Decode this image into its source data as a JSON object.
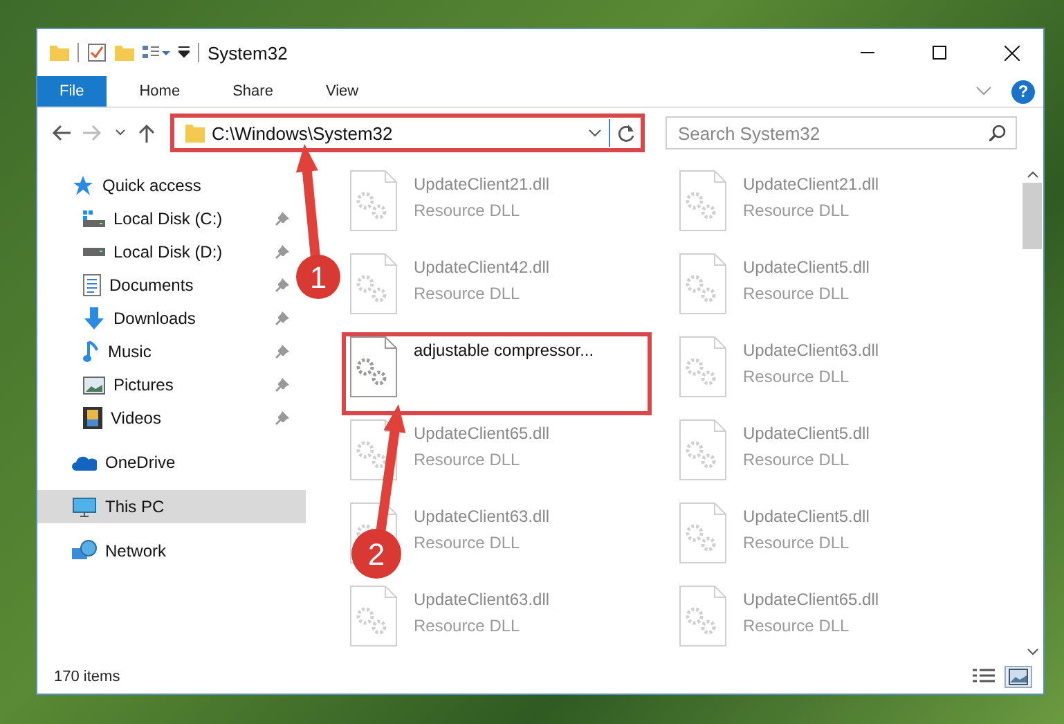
{
  "window": {
    "title": "System32"
  },
  "ribbon_tabs": [
    {
      "label": "File",
      "selected": true
    },
    {
      "label": "Home",
      "selected": false
    },
    {
      "label": "Share",
      "selected": false
    },
    {
      "label": "View",
      "selected": false
    }
  ],
  "help": {
    "glyph": "?"
  },
  "address_bar": {
    "path": "C:\\Windows\\System32",
    "highlighted": true
  },
  "search": {
    "placeholder": "Search System32"
  },
  "sidebar": {
    "items": [
      {
        "kind": "star",
        "label": "Quick access",
        "selected": false,
        "children": [
          {
            "kind": "drive-c",
            "label": "Local Disk (C:)",
            "pinned": true,
            "selected": false
          },
          {
            "kind": "drive",
            "label": "Local Disk (D:)",
            "pinned": true,
            "selected": false
          },
          {
            "kind": "documents",
            "label": "Documents",
            "pinned": true,
            "selected": false
          },
          {
            "kind": "downloads",
            "label": "Downloads",
            "pinned": true,
            "selected": false
          },
          {
            "kind": "music",
            "label": "Music",
            "pinned": true,
            "selected": false
          },
          {
            "kind": "pictures",
            "label": "Pictures",
            "pinned": true,
            "selected": false
          },
          {
            "kind": "videos",
            "label": "Videos",
            "pinned": true,
            "selected": false
          }
        ]
      },
      {
        "kind": "cloud",
        "label": "OneDrive",
        "selected": false
      },
      {
        "kind": "pc",
        "label": "This PC",
        "selected": true
      },
      {
        "kind": "network",
        "label": "Network",
        "selected": false
      }
    ]
  },
  "files": [
    {
      "name": "UpdateClient21.dll",
      "type": "Resource DLL",
      "faded": true,
      "highlighted": false
    },
    {
      "name": "UpdateClient21.dll",
      "type": "Resource DLL",
      "faded": true,
      "highlighted": false
    },
    {
      "name": "UpdateClient42.dll",
      "type": "Resource DLL",
      "faded": true,
      "highlighted": false
    },
    {
      "name": "UpdateClient5.dll",
      "type": "Resource DLL",
      "faded": true,
      "highlighted": false
    },
    {
      "name": "adjustable compressor...",
      "faded": false,
      "highlighted": true
    },
    {
      "name": "UpdateClient63.dll",
      "type": "Resource DLL",
      "faded": true,
      "highlighted": false
    },
    {
      "name": "UpdateClient65.dll",
      "type": "Resource DLL",
      "faded": true,
      "highlighted": false
    },
    {
      "name": "UpdateClient5.dll",
      "type": "Resource DLL",
      "faded": true,
      "highlighted": false
    },
    {
      "name": "UpdateClient63.dll",
      "type": "Resource DLL",
      "faded": true,
      "highlighted": false
    },
    {
      "name": "UpdateClient5.dll",
      "type": "Resource DLL",
      "faded": true,
      "highlighted": false
    },
    {
      "name": "UpdateClient63.dll",
      "type": "Resource DLL",
      "faded": true,
      "highlighted": false
    },
    {
      "name": "UpdateClient65.dll",
      "type": "Resource DLL",
      "faded": true,
      "highlighted": false
    }
  ],
  "status_bar": {
    "count": "170 items",
    "view_buttons": [
      {
        "kind": "details",
        "selected": false
      },
      {
        "kind": "large-icons",
        "selected": true
      }
    ]
  },
  "annotations": [
    {
      "number": "1"
    },
    {
      "number": "2"
    }
  ]
}
